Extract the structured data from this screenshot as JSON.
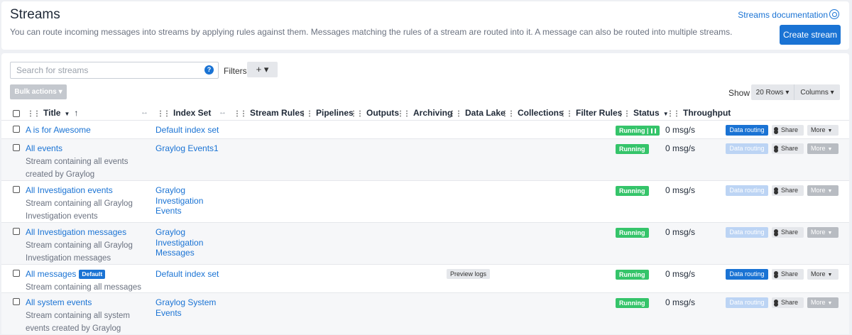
{
  "header": {
    "title": "Streams",
    "description": "You can route incoming messages into streams by applying rules against them. Messages matching the rules of a stream are routed into it. A message can also be routed into multiple streams.",
    "doc_link": "Streams documentation",
    "create_button": "Create stream"
  },
  "toolbar": {
    "search_placeholder": "Search for streams",
    "help_glyph": "?",
    "filters_label": "Filters",
    "filters_button": "+ ▾",
    "bulk_actions": "Bulk actions ▾",
    "show_label": "Show",
    "rows_button": "20 Rows ▾",
    "columns_button": "Columns ▾"
  },
  "columns": {
    "title": "Title",
    "index_set": "Index Set",
    "stream_rules": "Stream Rules",
    "pipelines": "Pipelines",
    "outputs": "Outputs",
    "archiving": "Archiving",
    "data_lake": "Data Lake",
    "collections": "Collections",
    "filter_rules": "Filter Rules",
    "status": "Status",
    "throughput": "Throughput"
  },
  "actions": {
    "data_routing": "Data routing",
    "share": "Share",
    "more": "More",
    "preview_logs": "Preview logs",
    "default_badge": "Default"
  },
  "rows": [
    {
      "title": "A is for Awesome",
      "description": "",
      "index_set": "Default index set",
      "status": "Running |",
      "throughput": "0 msg/s"
    },
    {
      "title": "All events",
      "description": "Stream containing all events created by Graylog",
      "index_set": "Graylog Events1",
      "status": "Running",
      "throughput": "0 msg/s"
    },
    {
      "title": "All Investigation events",
      "description": "Stream containing all Graylog Investigation events",
      "index_set": "Graylog Investigation Events",
      "status": "Running",
      "throughput": "0 msg/s"
    },
    {
      "title": "All Investigation messages",
      "description": "Stream containing all Graylog Investigation messages",
      "index_set": "Graylog Investigation Messages",
      "status": "Running",
      "throughput": "0 msg/s"
    },
    {
      "title": "All messages",
      "description": "Stream containing all messages",
      "index_set": "Default index set",
      "status": "Running",
      "throughput": "0 msg/s"
    },
    {
      "title": "All system events",
      "description": "Stream containing all system events created by Graylog",
      "index_set": "Graylog System Events",
      "status": "Running",
      "throughput": "0 msg/s"
    }
  ],
  "colors": {
    "accent": "#1a73d4",
    "running": "#35c46a",
    "disabled_routing": "#bcd4f4"
  }
}
